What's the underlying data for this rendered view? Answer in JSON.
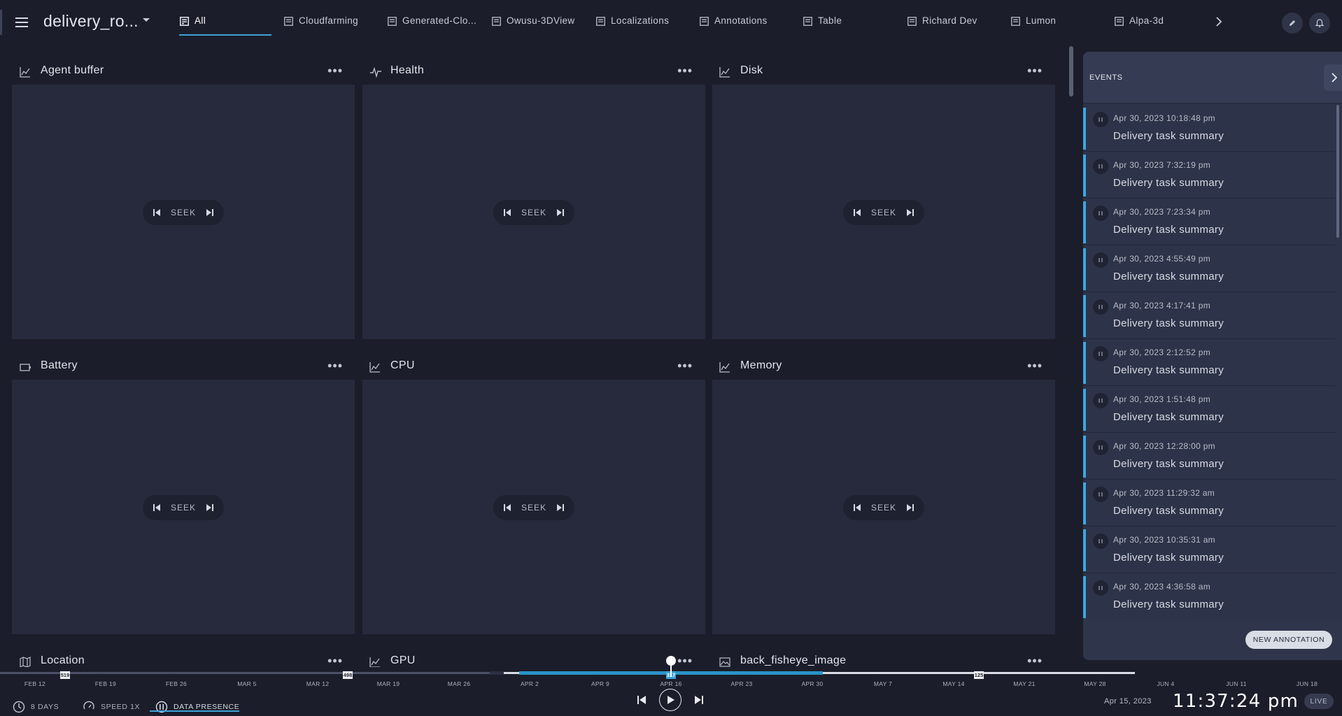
{
  "header": {
    "title": "delivery_ro...",
    "tabs": [
      {
        "label": "All"
      },
      {
        "label": "Cloudfarming"
      },
      {
        "label": "Generated-Clo..."
      },
      {
        "label": "Owusu-3DView"
      },
      {
        "label": "Localizations"
      },
      {
        "label": "Annotations"
      },
      {
        "label": "Table"
      },
      {
        "label": "Richard Dev"
      },
      {
        "label": "Lumon"
      },
      {
        "label": "Alpa-3d"
      }
    ],
    "active_tab": "All"
  },
  "panels": [
    {
      "title": "Agent buffer",
      "icon": "line-chart-icon",
      "seek_label": "SEEK"
    },
    {
      "title": "Health",
      "icon": "health-pulse-icon",
      "seek_label": "SEEK"
    },
    {
      "title": "Disk",
      "icon": "line-chart-icon",
      "seek_label": "SEEK"
    },
    {
      "title": "Battery",
      "icon": "battery-icon",
      "seek_label": "SEEK"
    },
    {
      "title": "CPU",
      "icon": "line-chart-icon",
      "seek_label": "SEEK"
    },
    {
      "title": "Memory",
      "icon": "line-chart-icon",
      "seek_label": "SEEK"
    },
    {
      "title": "Location",
      "icon": "map-icon"
    },
    {
      "title": "GPU",
      "icon": "line-chart-icon"
    },
    {
      "title": "back_fisheye_image",
      "icon": "image-icon"
    }
  ],
  "events": {
    "title": "EVENTS",
    "items": [
      {
        "time": "Apr 30, 2023 10:18:48 pm",
        "title": "Delivery task summary"
      },
      {
        "time": "Apr 30, 2023 7:32:19 pm",
        "title": "Delivery task summary"
      },
      {
        "time": "Apr 30, 2023 7:23:34 pm",
        "title": "Delivery task summary"
      },
      {
        "time": "Apr 30, 2023 4:55:49 pm",
        "title": "Delivery task summary"
      },
      {
        "time": "Apr 30, 2023 4:17:41 pm",
        "title": "Delivery task summary"
      },
      {
        "time": "Apr 30, 2023 2:12:52 pm",
        "title": "Delivery task summary"
      },
      {
        "time": "Apr 30, 2023 1:51:48 pm",
        "title": "Delivery task summary"
      },
      {
        "time": "Apr 30, 2023 12:28:00 pm",
        "title": "Delivery task summary"
      },
      {
        "time": "Apr 30, 2023 11:29:32 am",
        "title": "Delivery task summary"
      },
      {
        "time": "Apr 30, 2023 10:35:31 am",
        "title": "Delivery task summary"
      },
      {
        "time": "Apr 30, 2023 4:36:58 am",
        "title": "Delivery task summary"
      }
    ],
    "new_annotation_label": "NEW ANNOTATION"
  },
  "timeline": {
    "labels": [
      "FEB 12",
      "FEB 19",
      "FEB 26",
      "MAR 5",
      "MAR 12",
      "MAR 19",
      "MAR 26",
      "APR 2",
      "APR 9",
      "APR 16",
      "APR 23",
      "APR 30",
      "MAY 7",
      "MAY 14",
      "MAY 21",
      "MAY 28",
      "JUN 4",
      "JUN 11",
      "JUN 18"
    ],
    "markers": [
      "519",
      "498",
      "317",
      "125"
    ],
    "window_label": "8 DAYS",
    "speed_label": "SPEED 1X",
    "data_presence_label": "DATA PRESENCE",
    "current_date": "Apr 15, 2023",
    "current_time": "11:37:24 pm",
    "live_label": "LIVE"
  },
  "colors": {
    "accent": "#3ea2d8",
    "background": "#1b1e2a",
    "panel": "#262a3c",
    "events_panel": "#2d3348"
  }
}
